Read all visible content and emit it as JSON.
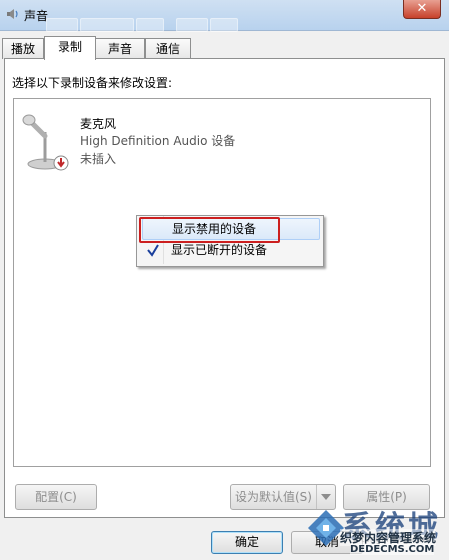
{
  "window": {
    "title": "声音",
    "close_glyph": "✕"
  },
  "tabs": [
    {
      "label": "播放",
      "active": false
    },
    {
      "label": "录制",
      "active": true
    },
    {
      "label": "声音",
      "active": false
    },
    {
      "label": "通信",
      "active": false
    }
  ],
  "panel": {
    "instruction": "选择以下录制设备来修改设置:"
  },
  "device": {
    "name": "麦克风",
    "description": "High Definition Audio 设备",
    "status": "未插入",
    "icon": "microphone-icon"
  },
  "context_menu": {
    "items": [
      {
        "label": "显示禁用的设备",
        "checked": false,
        "highlighted": true
      },
      {
        "label": "显示已断开的设备",
        "checked": true,
        "highlighted": false
      }
    ],
    "check_glyph": "✓"
  },
  "buttons": {
    "configure": "配置(C)",
    "set_default": "设为默认值(S)",
    "properties": "属性(P)",
    "ok": "确定",
    "cancel": "取消"
  },
  "watermark": {
    "big_text": "系统城",
    "site_text": "xitongcheng.com",
    "cn_text": "织梦内容管理系统",
    "domain_text": "DEDECMS.COM"
  },
  "colors": {
    "highlight_border": "#cc1f1f",
    "checkmark": "#1a3f9c"
  }
}
